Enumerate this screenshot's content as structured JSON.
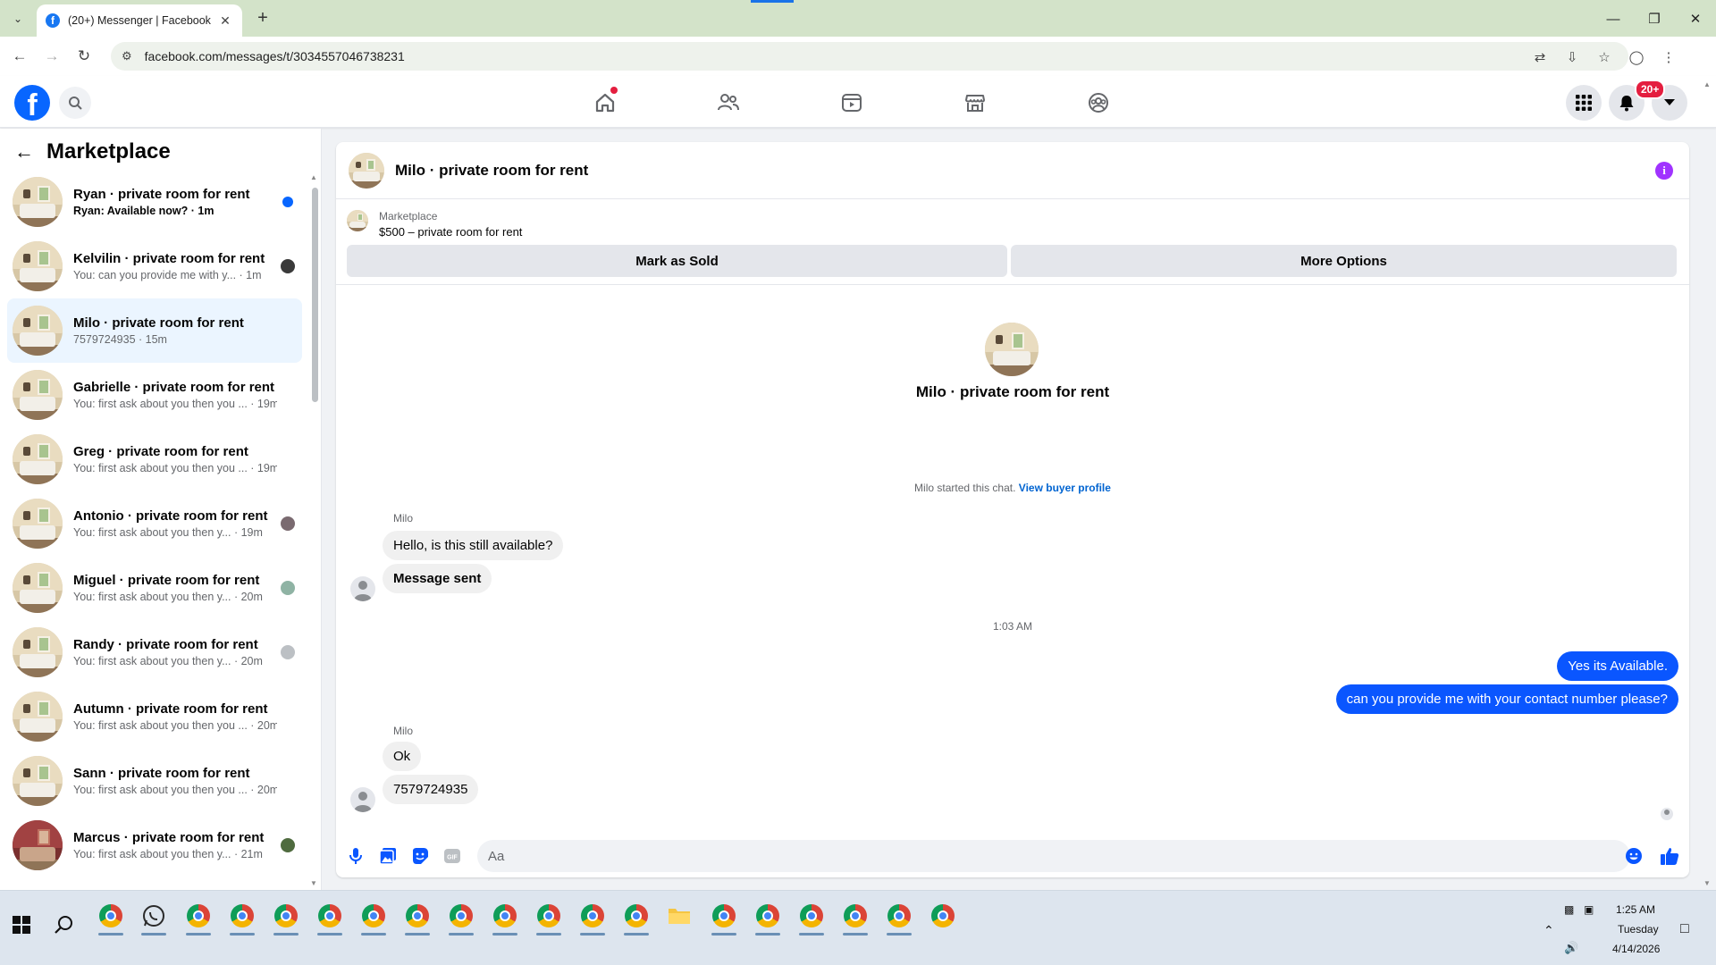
{
  "browser": {
    "tab_title": "(20+) Messenger | Facebook",
    "url": "facebook.com/messages/t/3034557046738231",
    "tab_favicon": "facebook-icon"
  },
  "fb_header": {
    "notification_badge": "20+",
    "home_has_dot": true,
    "colors": {
      "brand": "#0866ff",
      "badge": "#e41e3f"
    }
  },
  "sidebar": {
    "title": "Marketplace",
    "conversations": [
      {
        "name": "Ryan · private room for rent",
        "preview": "Ryan: Available now? · 1m",
        "unread": true,
        "indicator": "unread-dot"
      },
      {
        "name": "Kelvilin · private room for rent",
        "preview": "You: can you provide me with y... · 1m",
        "indicator": "seen-avatar"
      },
      {
        "name": "Milo · private room for rent",
        "preview": "7579724935 · 15m",
        "active": true,
        "indicator": "none"
      },
      {
        "name": "Gabrielle · private room for rent",
        "preview": "You: first ask about you then you ... · 19m",
        "indicator": "none"
      },
      {
        "name": "Greg · private room for rent",
        "preview": "You: first ask about you then you ... · 19m",
        "indicator": "none"
      },
      {
        "name": "Antonio · private room for rent",
        "preview": "You: first ask about you then y... · 19m",
        "indicator": "seen-avatar"
      },
      {
        "name": "Miguel · private room for rent",
        "preview": "You: first ask about you then y... · 20m",
        "indicator": "seen-avatar"
      },
      {
        "name": "Randy · private room for rent",
        "preview": "You: first ask about you then y... · 20m",
        "indicator": "seen-avatar"
      },
      {
        "name": "Autumn · private room for rent",
        "preview": "You: first ask about you then you ... · 20m",
        "indicator": "none"
      },
      {
        "name": "Sann · private room for rent",
        "preview": "You: first ask about you then you ... · 20m",
        "indicator": "none"
      },
      {
        "name": "Marcus · private room for rent",
        "preview": "You: first ask about you then y... · 21m",
        "indicator": "seen-avatar",
        "thumb": "red"
      }
    ]
  },
  "chat": {
    "title": "Milo · private room for rent",
    "listing": {
      "source": "Marketplace",
      "price_title": "$500 – private room for rent",
      "mark_sold": "Mark as Sold",
      "more_options": "More Options"
    },
    "intro_name": "Milo · private room for rent",
    "started_text": "Milo started this chat.",
    "view_profile": "View buyer profile",
    "group1": {
      "sender": "Milo",
      "messages": [
        "Hello, is this still available?",
        "Message sent"
      ]
    },
    "timestamp": "1:03 AM",
    "outgoing": [
      "Yes its Available.",
      "can you provide me with your contact number please?"
    ],
    "group2": {
      "sender": "Milo",
      "messages": [
        "Ok",
        "7579724935"
      ]
    },
    "composer_placeholder": "Aa",
    "colors": {
      "outgoing_bubble": "#0a56ff",
      "info_icon": "#a033ff"
    }
  },
  "taskbar": {
    "time": "1:25 AM",
    "day": "Tuesday",
    "date": "4/14/2026"
  }
}
